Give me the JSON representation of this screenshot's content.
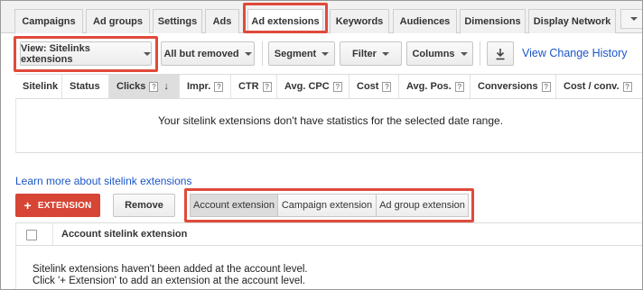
{
  "tabs": [
    {
      "label": "Campaigns"
    },
    {
      "label": "Ad groups"
    },
    {
      "label": "Settings"
    },
    {
      "label": "Ads"
    },
    {
      "label": "Ad extensions",
      "active": true
    },
    {
      "label": "Keywords"
    },
    {
      "label": "Audiences"
    },
    {
      "label": "Dimensions"
    },
    {
      "label": "Display Network"
    }
  ],
  "toolbar": {
    "view_label": "View: Sitelinks extensions",
    "filter_removed_label": "All but removed",
    "segment_label": "Segment",
    "filter_label": "Filter",
    "columns_label": "Columns",
    "download_icon": "download-icon",
    "view_change_history": "View Change History"
  },
  "table": {
    "columns": [
      {
        "label": "Sitelink",
        "help": false
      },
      {
        "label": "Status",
        "help": false
      },
      {
        "label": "Clicks",
        "help": true,
        "sorted": true
      },
      {
        "label": "Impr.",
        "help": true
      },
      {
        "label": "CTR",
        "help": true
      },
      {
        "label": "Avg. CPC",
        "help": true
      },
      {
        "label": "Cost",
        "help": true
      },
      {
        "label": "Avg. Pos.",
        "help": true
      },
      {
        "label": "Conversions",
        "help": true
      },
      {
        "label": "Cost / conv.",
        "help": true
      }
    ],
    "help_glyph": "?",
    "sort_glyph": "↓",
    "empty_message": "Your sitelink extensions don't have statistics for the selected date range."
  },
  "learn_more": "Learn more about sitelink extensions",
  "actions": {
    "extension_label": "EXTENSION",
    "plus_glyph": "+",
    "remove_label": "Remove"
  },
  "level_tabs": [
    {
      "label": "Account extension",
      "selected": true
    },
    {
      "label": "Campaign extension"
    },
    {
      "label": "Ad group extension"
    }
  ],
  "sub_table": {
    "header": "Account sitelink extension",
    "note_line1": "Sitelink extensions haven't been added at the account level.",
    "note_line2": "Click '+ Extension' to add an extension at the account level."
  },
  "colors": {
    "highlight": "#e04a3a",
    "extension_button": "#d64535",
    "link": "#1a56c8"
  }
}
